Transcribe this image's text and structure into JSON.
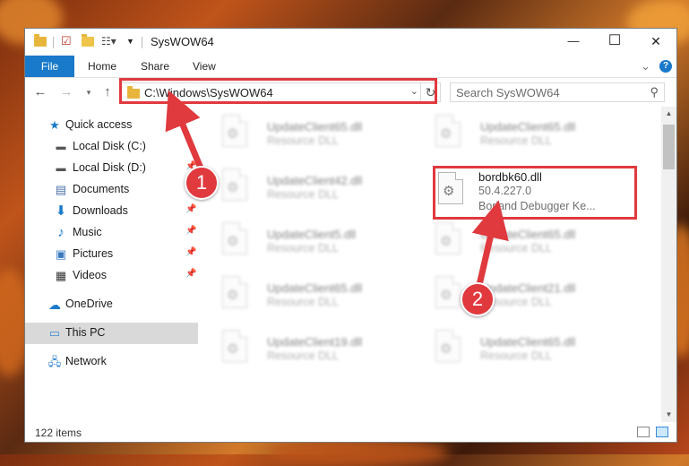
{
  "window": {
    "title": "SysWOW64",
    "minimize_glyph": "—",
    "maximize_glyph": "☐",
    "close_glyph": "✕"
  },
  "ribbon": {
    "tabs": [
      "File",
      "Home",
      "Share",
      "View"
    ],
    "expand_glyph": "⌄",
    "help_glyph": "?"
  },
  "address": {
    "path": "C:\\Windows\\SysWOW64",
    "search_placeholder": "Search SysWOW64"
  },
  "sidebar": {
    "items": [
      {
        "label": "Quick access",
        "icon": "star-icon",
        "pinned": false
      },
      {
        "label": "Local Disk (C:)",
        "icon": "drive-icon",
        "pinned": false
      },
      {
        "label": "Local Disk (D:)",
        "icon": "drive-icon",
        "pinned": true
      },
      {
        "label": "Documents",
        "icon": "documents-icon",
        "pinned": true
      },
      {
        "label": "Downloads",
        "icon": "downloads-icon",
        "pinned": true
      },
      {
        "label": "Music",
        "icon": "music-icon",
        "pinned": true
      },
      {
        "label": "Pictures",
        "icon": "pictures-icon",
        "pinned": true
      },
      {
        "label": "Videos",
        "icon": "videos-icon",
        "pinned": true
      },
      {
        "label": "OneDrive",
        "icon": "cloud-icon",
        "pinned": false
      },
      {
        "label": "This PC",
        "icon": "computer-icon",
        "pinned": false,
        "selected": true
      },
      {
        "label": "Network",
        "icon": "network-icon",
        "pinned": false
      }
    ]
  },
  "files": [
    {
      "name": "UpdateClient65.dll",
      "type": "Resource DLL",
      "blurred": true
    },
    {
      "name": "UpdateClient65.dll",
      "type": "Resource DLL",
      "blurred": true
    },
    {
      "name": "UpdateClient42.dll",
      "type": "Resource DLL",
      "blurred": true
    },
    {
      "name": "bordbk60.dll",
      "version": "50.4.227.0",
      "description": "Borland Debugger Ke...",
      "blurred": false
    },
    {
      "name": "UpdateClient5.dll",
      "type": "Resource DLL",
      "blurred": true
    },
    {
      "name": "UpdateClient65.dll",
      "type": "Resource DLL",
      "blurred": true
    },
    {
      "name": "UpdateClient65.dll",
      "type": "Resource DLL",
      "blurred": true
    },
    {
      "name": "UpdateClient21.dll",
      "type": "Resource DLL",
      "blurred": true
    },
    {
      "name": "UpdateClient19.dll",
      "type": "Resource DLL",
      "blurred": true
    },
    {
      "name": "UpdateClient65.dll",
      "type": "Resource DLL",
      "blurred": true
    }
  ],
  "status": {
    "item_count": "122 items"
  },
  "annotations": {
    "step1": "1",
    "step2": "2",
    "color": "#e0393e"
  }
}
